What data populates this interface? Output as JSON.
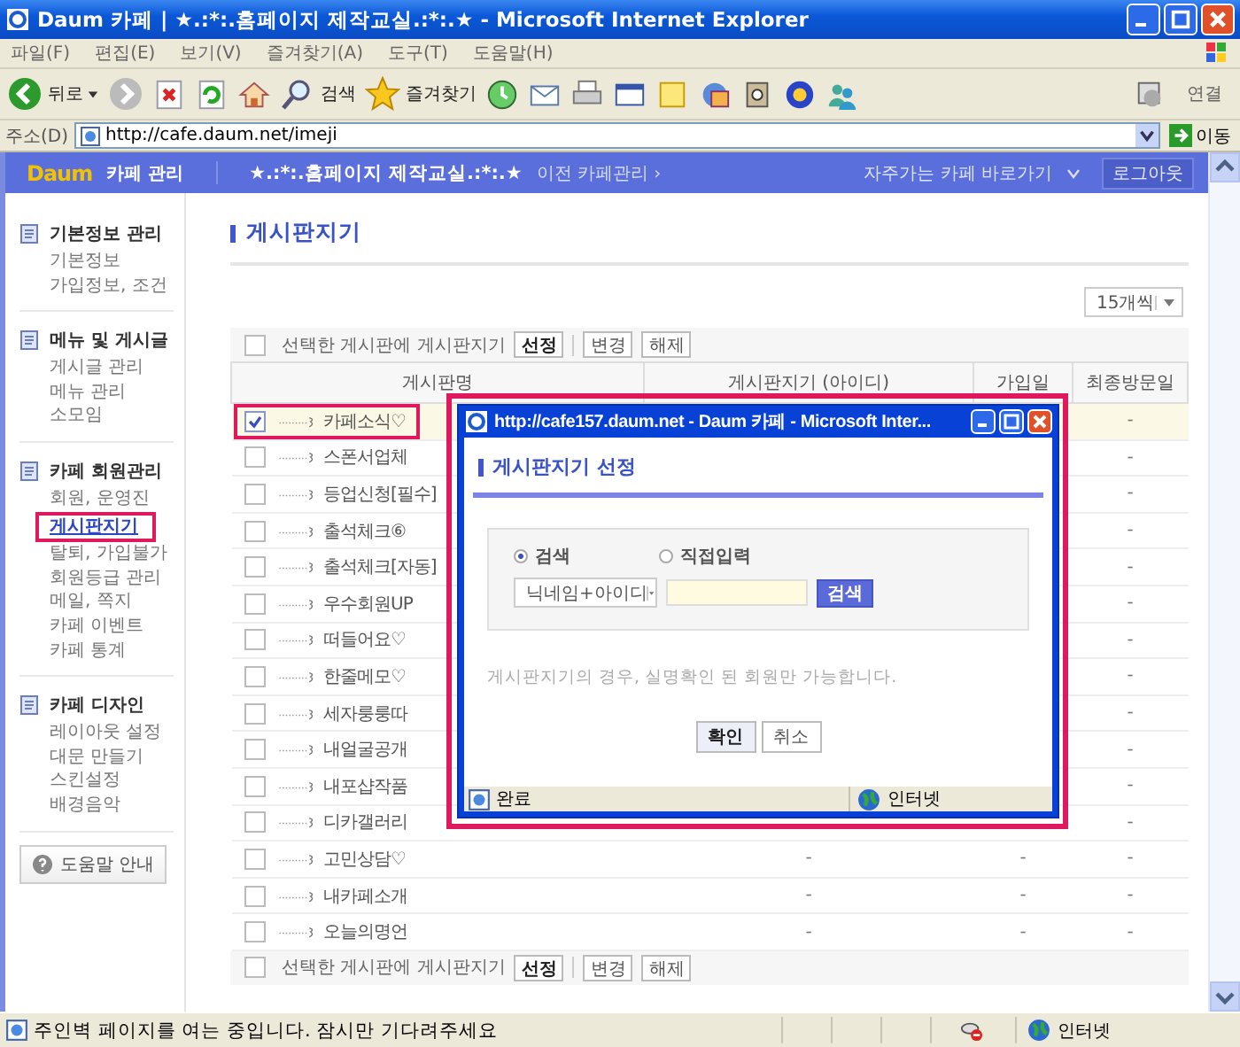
{
  "window": {
    "title": "Daum 카페 | ★.:*:.홈페이지 제작교실.:*:.★ - Microsoft Internet Explorer"
  },
  "menu": [
    "파일(F)",
    "편집(E)",
    "보기(V)",
    "즐겨찾기(A)",
    "도구(T)",
    "도움말(H)"
  ],
  "toolbar": {
    "back": "뒤로",
    "search": "검색",
    "favorites": "즐겨찾기",
    "links": "연결"
  },
  "address": {
    "label": "주소(D)",
    "url": "http://cafe.daum.net/imeji",
    "go": "이동"
  },
  "header": {
    "logo": "Daum",
    "title": "카페 관리",
    "cafe": "★.:*:.홈페이지 제작교실.:*:.★",
    "prev": "이전 카페관리 ›",
    "shortcut": "자주가는 카페 바로가기",
    "logout": "로그아웃"
  },
  "sidebar": {
    "groups": [
      {
        "title": "기본정보 관리",
        "items": [
          {
            "label": "기본정보",
            "selected": false
          },
          {
            "label": "가입정보, 조건",
            "selected": false
          }
        ]
      },
      {
        "title": "메뉴 및 게시글",
        "items": [
          {
            "label": "게시글 관리",
            "selected": false
          },
          {
            "label": "메뉴 관리",
            "selected": false
          },
          {
            "label": "소모임",
            "selected": false
          }
        ]
      },
      {
        "title": "카페 회원관리",
        "items": [
          {
            "label": "회원, 운영진",
            "selected": false
          },
          {
            "label": "게시판지기",
            "selected": true
          },
          {
            "label": "탈퇴, 가입불가",
            "selected": false
          },
          {
            "label": "회원등급 관리",
            "selected": false
          },
          {
            "label": "메일, 쪽지",
            "selected": false
          },
          {
            "label": "카페 이벤트",
            "selected": false
          },
          {
            "label": "카페 통계",
            "selected": false
          }
        ]
      },
      {
        "title": "카페 디자인",
        "items": [
          {
            "label": "레이아웃 설정",
            "selected": false
          },
          {
            "label": "대문 만들기",
            "selected": false
          },
          {
            "label": "스킨설정",
            "selected": false
          },
          {
            "label": "배경음악",
            "selected": false
          }
        ]
      }
    ],
    "help": "도움말 안내"
  },
  "main": {
    "title": "게시판지기",
    "per_page": "15개씩",
    "action_bars": [
      {
        "checked": false,
        "label": "선택한 게시판에 게시판지기",
        "buttons": [
          "선정",
          "변경",
          "해제"
        ]
      },
      {
        "checked": false,
        "label": "선택한 게시판에 게시판지기",
        "buttons": [
          "선정",
          "변경",
          "해제"
        ]
      }
    ],
    "table": {
      "columns": [
        "게시판명",
        "게시판지기 (아이디)",
        "가입일",
        "최종방문일"
      ],
      "rows": [
        {
          "name": "카페소식♡",
          "checked": true,
          "last": "-"
        },
        {
          "name": "스폰서업체",
          "checked": false,
          "last": "-"
        },
        {
          "name": "등업신청[필수]",
          "checked": false,
          "last": "-"
        },
        {
          "name": "출석체크⑥",
          "checked": false,
          "last": "-"
        },
        {
          "name": "출석체크[자동]",
          "checked": false,
          "last": "-"
        },
        {
          "name": "우수회원UP",
          "checked": false,
          "last": "-"
        },
        {
          "name": "떠들어요♡",
          "checked": false,
          "last": "-"
        },
        {
          "name": "한줄메모♡",
          "checked": false,
          "last": "-"
        },
        {
          "name": "세자룽룽따",
          "checked": false,
          "last": "-"
        },
        {
          "name": "내얼굴공개",
          "checked": false,
          "last": "-"
        },
        {
          "name": "내포샵작품",
          "checked": false,
          "last": "-"
        },
        {
          "name": "디카갤러리",
          "checked": false,
          "last": "-"
        },
        {
          "name": "고민상담♡",
          "checked": false,
          "keeper": "-",
          "joined": "-",
          "last": "-"
        },
        {
          "name": "내카페소개",
          "checked": false,
          "keeper": "-",
          "joined": "-",
          "last": "-"
        },
        {
          "name": "오늘의명언",
          "checked": false,
          "keeper": "-",
          "joined": "-",
          "last": "-"
        }
      ]
    }
  },
  "popup": {
    "title": "http://cafe157.daum.net - Daum 카페 - Microsoft Inter...",
    "heading": "게시판지기 선정",
    "radios": [
      {
        "label": "검색",
        "selected": true
      },
      {
        "label": "직접입력",
        "selected": false
      }
    ],
    "select": "닉네임+아이디",
    "search_button": "검색",
    "note": "게시판지기의 경우, 실명확인 된 회원만 가능합니다.",
    "buttons": [
      "확인",
      "취소"
    ],
    "status": "완료",
    "zone": "인터넷"
  },
  "status_bar": {
    "text": "주인벽 페이지를 여는 중입니다. 잠시만 기다려주세요",
    "zone": "인터넷"
  }
}
